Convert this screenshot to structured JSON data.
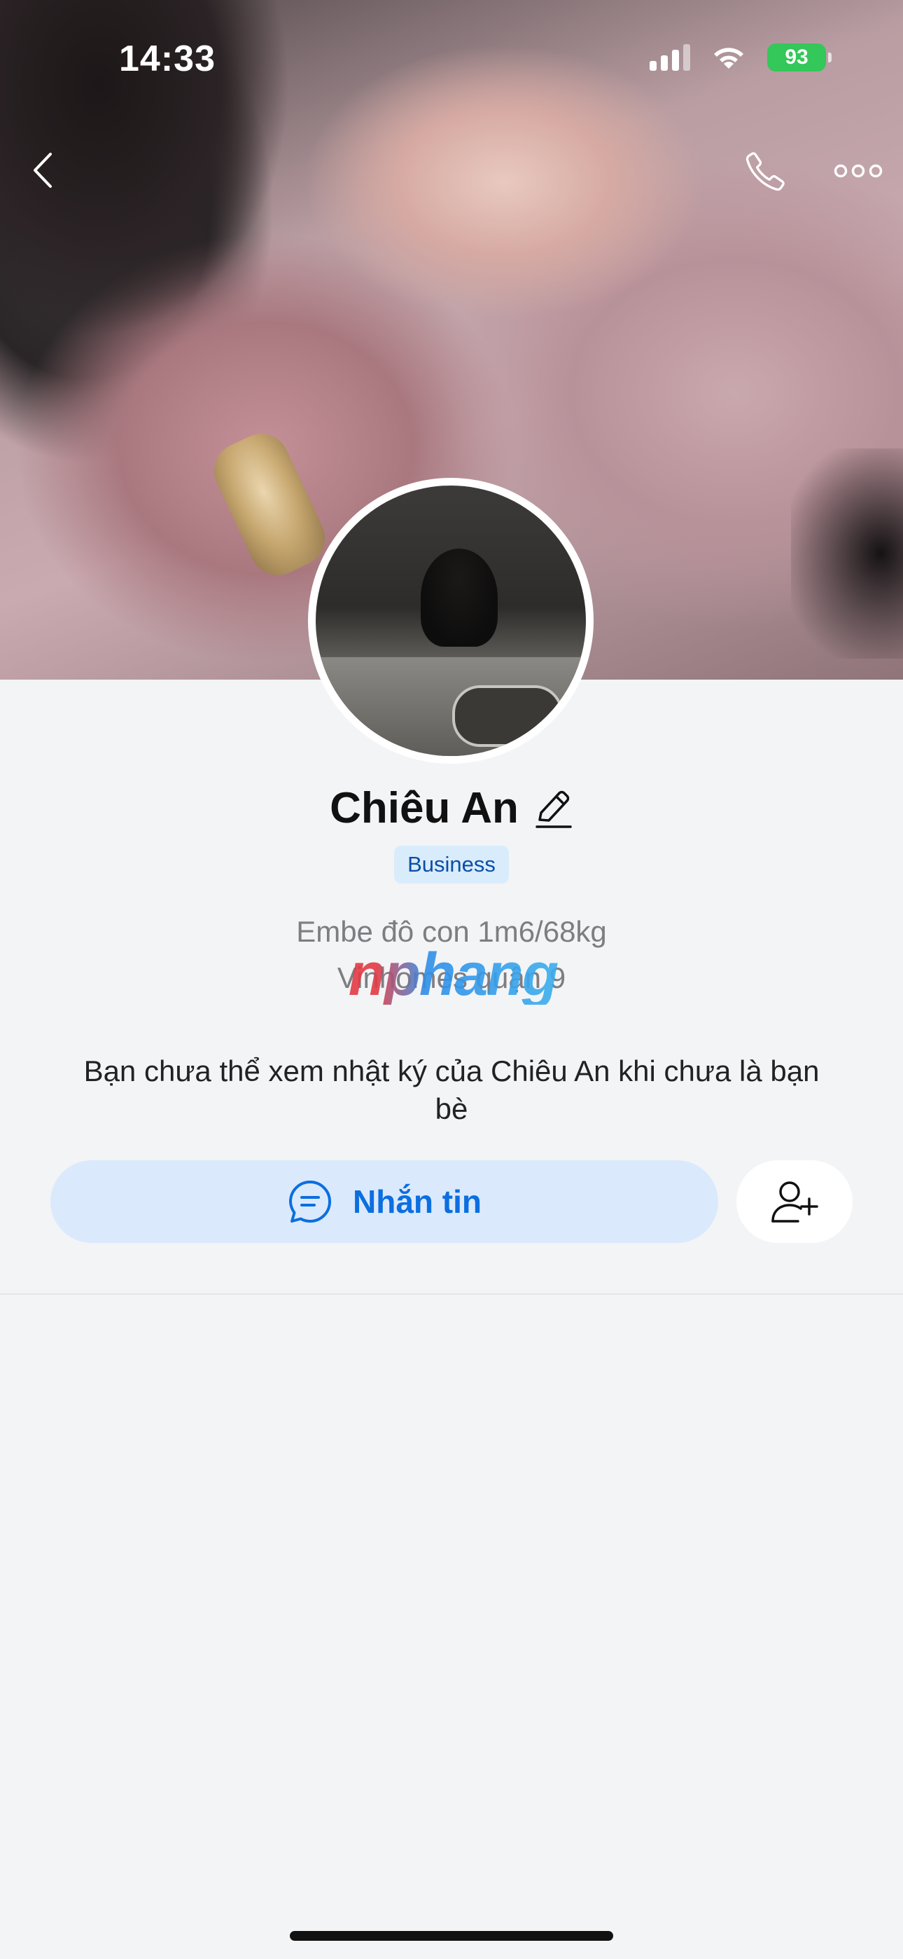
{
  "status_bar": {
    "time": "14:33",
    "battery": "93"
  },
  "nav": {
    "back_icon": "chevron-left-icon",
    "call_icon": "phone-icon",
    "more_icon": "more-horizontal-icon"
  },
  "profile": {
    "name": "Chiêu An",
    "badge": "Business",
    "bio_line_1": "Embe đô con 1m6/68kg",
    "bio_line_2": "Vinhomes quận 9",
    "privacy_note": "Bạn chưa thể xem nhật ký của Chiêu An khi chưa là bạn bè"
  },
  "watermark": "nphang",
  "actions": {
    "message_label": "Nhắn tin",
    "message_icon": "chat-bubble-icon",
    "add_friend_icon": "add-user-icon"
  },
  "colors": {
    "accent": "#0b6fe0",
    "button_bg": "#dbe9fc",
    "badge_bg": "#d9ecfb",
    "badge_text": "#0a4ea8",
    "battery": "#34c759",
    "background": "#f3f4f6"
  }
}
